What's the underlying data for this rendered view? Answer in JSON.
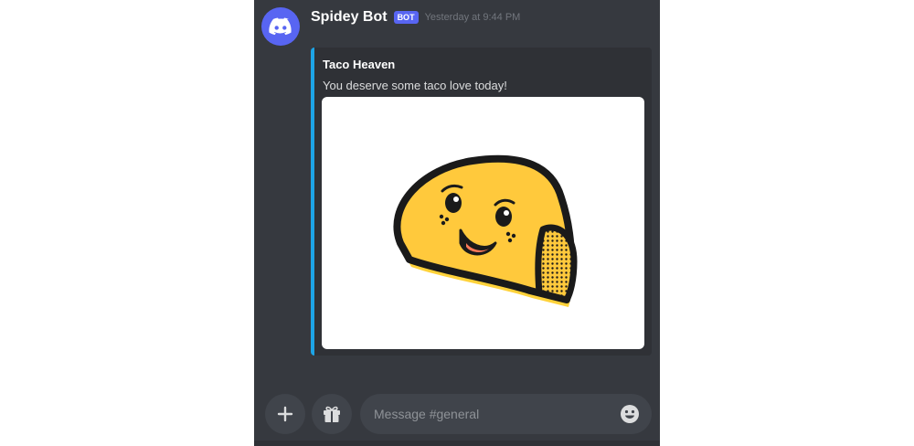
{
  "message": {
    "author": "Spidey Bot",
    "bot_tag": "BOT",
    "timestamp": "Yesterday at 9:44 PM",
    "avatar_icon": "discord-logo-icon"
  },
  "embed": {
    "accent_color": "#1da4e6",
    "title": "Taco Heaven",
    "description": "You deserve some taco love today!",
    "image": "smiling-taco-illustration"
  },
  "composer": {
    "placeholder": "Message #general",
    "add_icon": "plus-icon",
    "gift_icon": "gift-icon",
    "emoji_icon": "emoji-icon"
  },
  "colors": {
    "background": "#36393f",
    "blurple": "#5865f2",
    "embed_bg": "#2f3136",
    "input_bg": "#40444b"
  }
}
